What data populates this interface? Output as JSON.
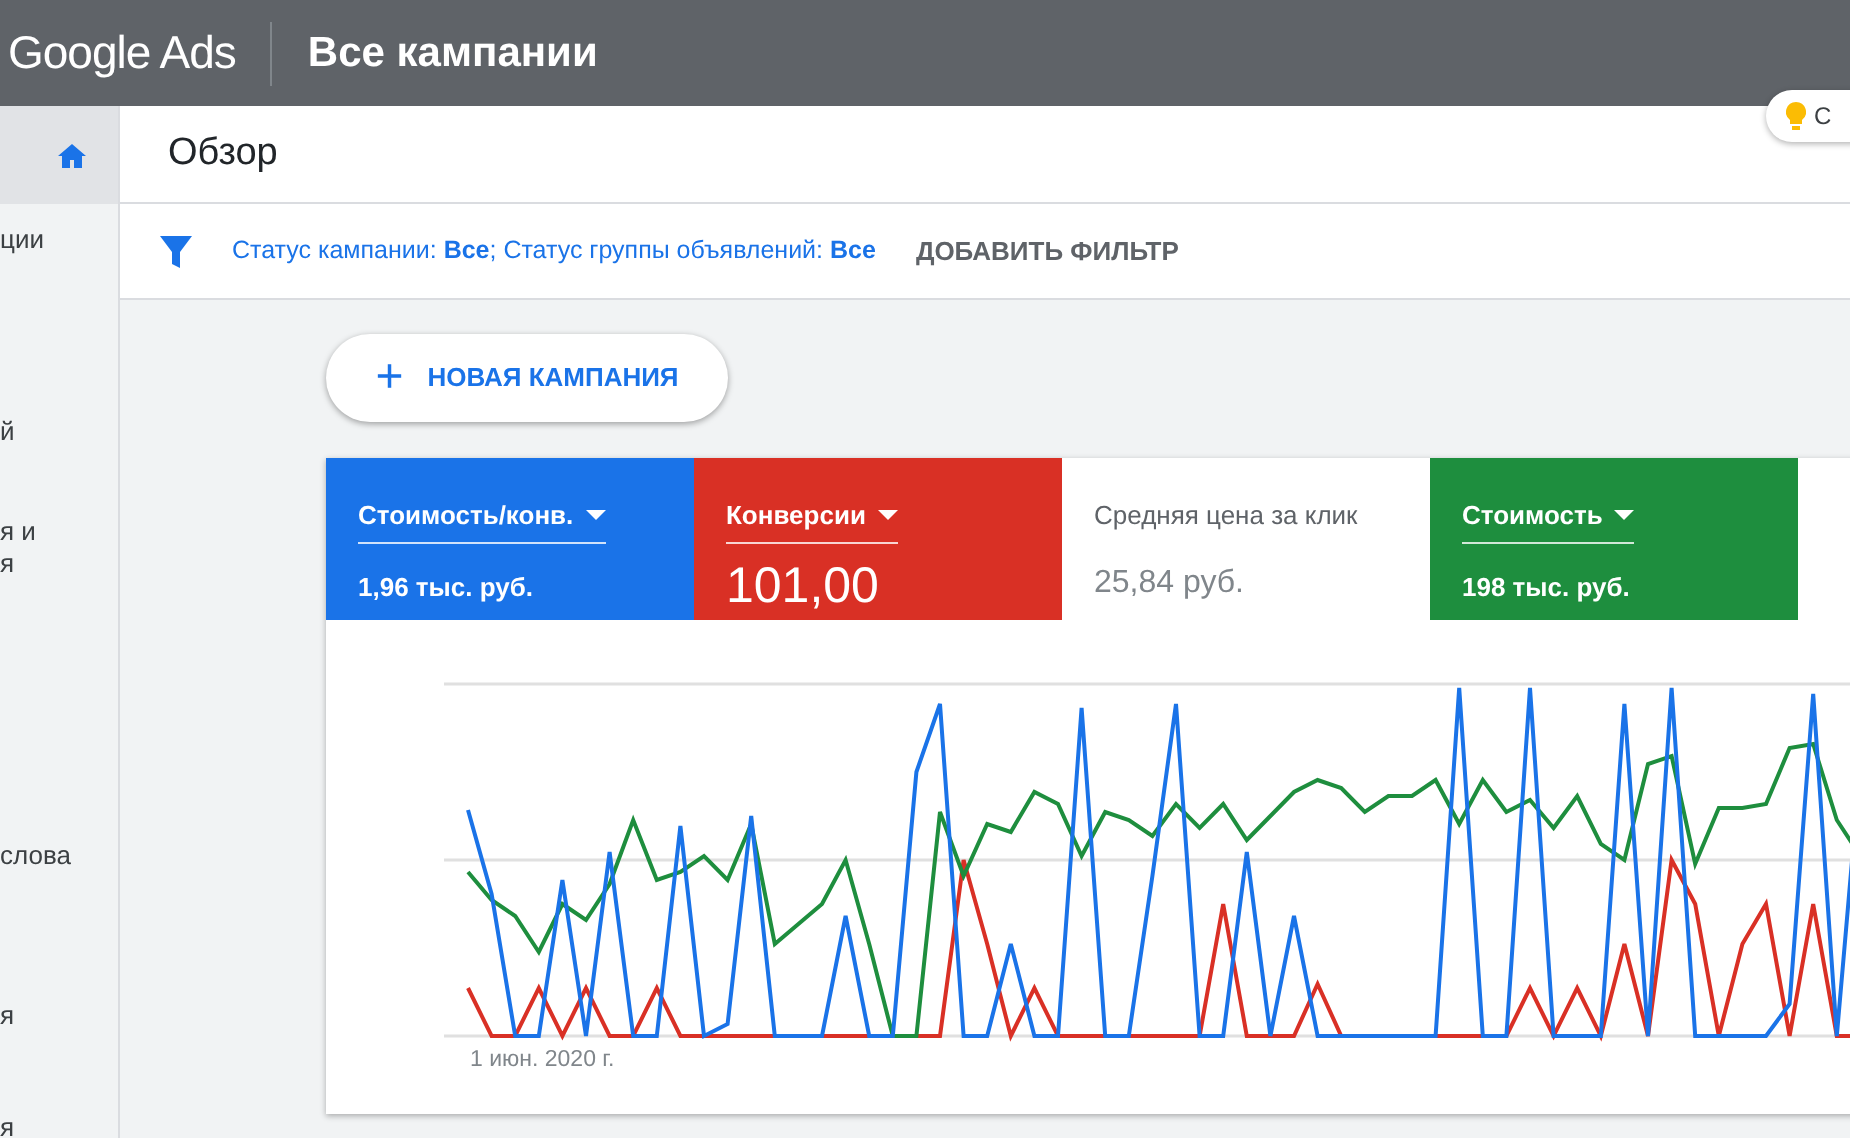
{
  "header": {
    "logo": "Google Ads",
    "title": "Все кампании"
  },
  "tip_chip": {
    "label": "С"
  },
  "sidebar": {
    "items": [
      {
        "kind": "icon",
        "selected": true
      },
      {
        "kind": "text",
        "lines": [
          "ции"
        ],
        "selected": false
      },
      {
        "kind": "text",
        "lines": [
          "й"
        ],
        "selected": false
      },
      {
        "kind": "text",
        "lines": [
          "я и",
          "я"
        ],
        "selected": false
      },
      {
        "kind": "text",
        "lines": [
          "слова"
        ],
        "selected": false
      },
      {
        "kind": "text",
        "lines": [
          "я"
        ],
        "selected": false
      },
      {
        "kind": "text",
        "lines": [
          "я"
        ],
        "selected": false
      }
    ]
  },
  "page_title": "Обзор",
  "filter_bar": {
    "filters": [
      {
        "label": "Статус кампании: ",
        "value": "Все"
      },
      {
        "label": "; Статус группы объявлений: ",
        "value": "Все"
      }
    ],
    "add_filter": "ДОБАВИТЬ ФИЛЬТР"
  },
  "new_campaign_button": {
    "icon": "+",
    "label": "НОВАЯ КАМПАНИЯ"
  },
  "metrics": [
    {
      "label": "Стоимость/конв.",
      "value": "1,96 тыс. руб.",
      "selected": true,
      "emphasized": false,
      "color": "#1a73e8"
    },
    {
      "label": "Конверсии",
      "value": "101,00",
      "selected": true,
      "emphasized": true,
      "color": "#d93025"
    },
    {
      "label": "Средняя цена за клик",
      "value": "25,84 руб.",
      "selected": false,
      "emphasized": false,
      "color": "#ffffff"
    },
    {
      "label": "Стоимость",
      "value": "198 тыс. руб.",
      "selected": true,
      "emphasized": false,
      "color": "#1e8e3e"
    }
  ],
  "chart": {
    "x_label": "1 июн. 2020 г."
  }
}
